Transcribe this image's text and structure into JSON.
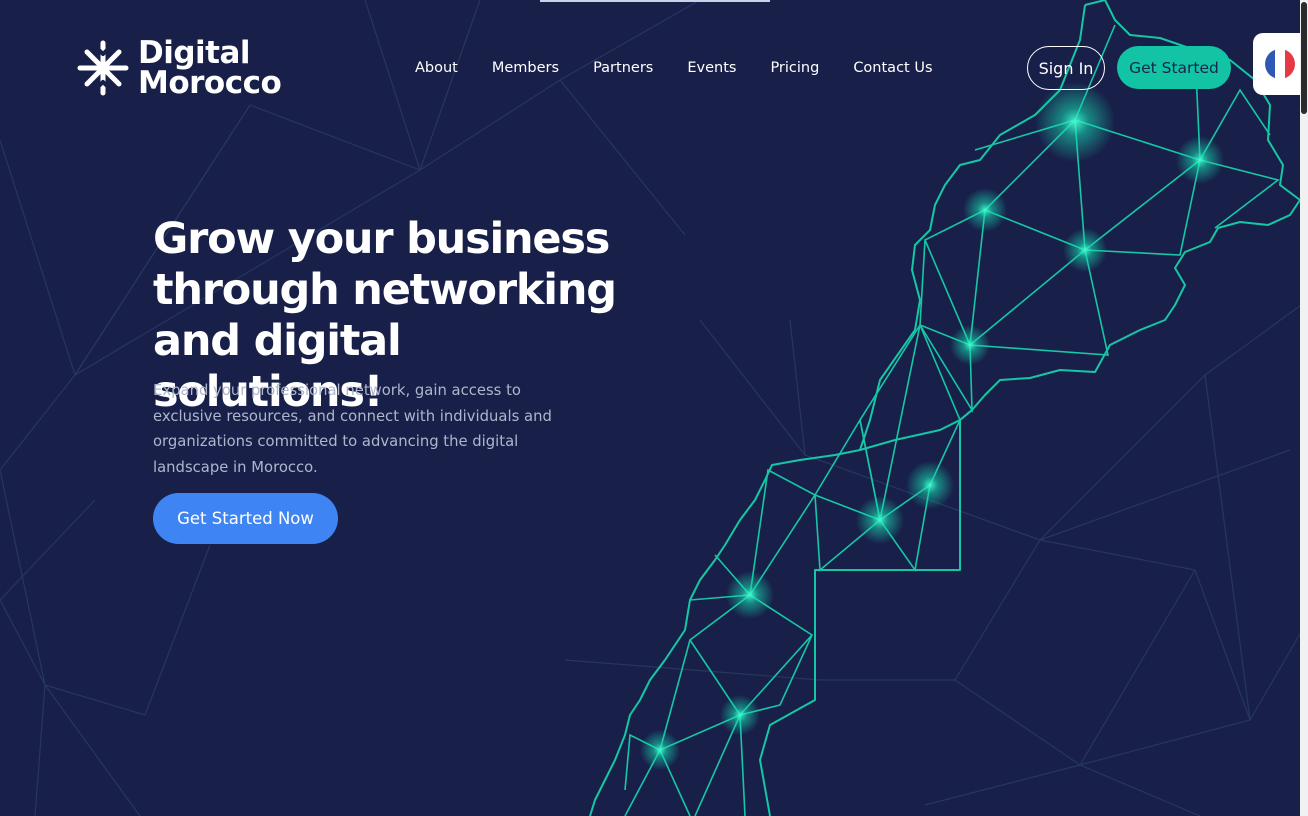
{
  "brand": {
    "line1": "Digital",
    "line2": "Morocco"
  },
  "nav": {
    "items": [
      "About",
      "Members",
      "Partners",
      "Events",
      "Pricing",
      "Contact Us"
    ]
  },
  "header": {
    "signin_label": "Sign In",
    "getstarted_label": "Get Started"
  },
  "language": {
    "icon": "french-flag-icon",
    "colors": [
      "#2f58b5",
      "#ffffff",
      "#e63946"
    ]
  },
  "hero": {
    "title": "Grow your business through networking and digital solutions!",
    "description": "Expand your professional network, gain access to exclusive resources, and connect with individuals and organizations committed to advancing the digital landscape in Morocco.",
    "cta_label": "Get Started Now"
  },
  "colors": {
    "background": "#18204a",
    "accent": "#12c3a4",
    "cta": "#3f84f3",
    "network": "#26365f"
  }
}
